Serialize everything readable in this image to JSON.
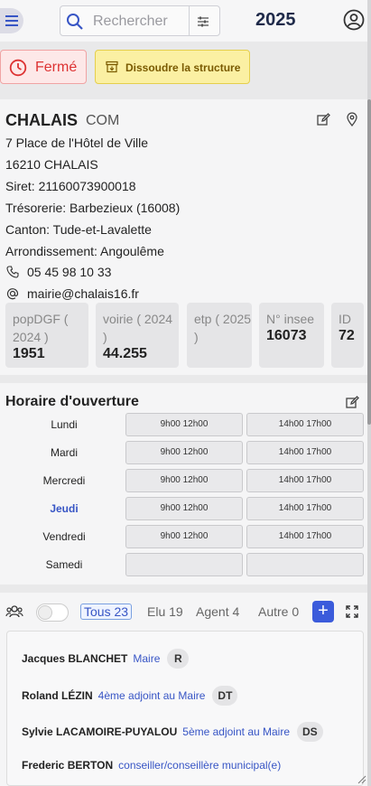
{
  "header": {
    "search_placeholder": "Rechercher",
    "year": "2025"
  },
  "status": {
    "closed_label": "Fermé",
    "dissolve_label": "Dissoudre la structure"
  },
  "entity": {
    "name": "CHALAIS",
    "type": "COM",
    "address_line": "7  Place de l'Hôtel de Ville",
    "postcode_city": "16210  CHALAIS",
    "siret": "Siret: 21160073900018",
    "tresorerie": "Trésorerie: Barbezieux (16008)",
    "canton": "Canton: Tude-et-Lavalette",
    "arrondissement": "Arrondissement: Angoulême",
    "phone": "05 45 98 10 33",
    "email": "mairie@chalais16.fr",
    "stats": [
      {
        "label": "popDGF ( 2024 )",
        "value": "1951"
      },
      {
        "label": "voirie ( 2024 )",
        "value": "44.255"
      },
      {
        "label": "etp ( 2025 )",
        "value": ""
      },
      {
        "label": "N° insee",
        "value": "16073"
      },
      {
        "label": "ID",
        "value": "72"
      }
    ]
  },
  "hours": {
    "title": "Horaire d'ouverture",
    "days": [
      {
        "day": "Lundi",
        "am": "9h00 12h00",
        "pm": "14h00 17h00",
        "today": false
      },
      {
        "day": "Mardi",
        "am": "9h00 12h00",
        "pm": "14h00 17h00",
        "today": false
      },
      {
        "day": "Mercredi",
        "am": "9h00 12h00",
        "pm": "14h00 17h00",
        "today": false
      },
      {
        "day": "Jeudi",
        "am": "9h00 12h00",
        "pm": "14h00 17h00",
        "today": true
      },
      {
        "day": "Vendredi",
        "am": "9h00 12h00",
        "pm": "14h00 17h00",
        "today": false
      },
      {
        "day": "Samedi",
        "am": "",
        "pm": "",
        "today": false
      }
    ]
  },
  "contacts": {
    "tabs": [
      {
        "label": "Tous 23",
        "active": true
      },
      {
        "label": "Elu 19",
        "active": false
      },
      {
        "label": "Agent 4",
        "active": false
      },
      {
        "label": "Autre 0",
        "active": false
      }
    ],
    "add_label": "+",
    "people": [
      {
        "name": "Jacques BLANCHET",
        "role": "Maire",
        "initials": "R"
      },
      {
        "name": "Roland LÉZIN",
        "role": "4ème adjoint au Maire",
        "initials": "DT"
      },
      {
        "name": "Sylvie LACAMOIRE-PUYALOU",
        "role": "5ème adjoint au Maire",
        "initials": "DS"
      },
      {
        "name": "Frederic BERTON",
        "role": "conseiller/conseillère municipal(e)",
        "initials": ""
      }
    ]
  },
  "colors": {
    "accent": "#3755c5",
    "closed": "#d33333",
    "dissolve_bg": "#fbf0a3"
  }
}
